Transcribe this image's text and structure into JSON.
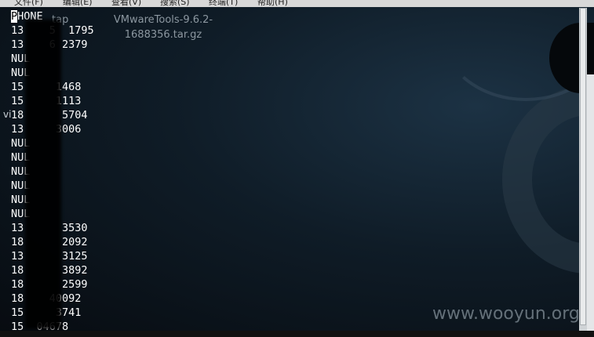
{
  "menubar": {
    "items": [
      "文件(F)",
      "编辑(E)",
      "查看(V)",
      "搜索(S)",
      "终端(T)",
      "帮助(H)"
    ]
  },
  "desktop": {
    "icon_left_label": "tap",
    "icon_label_line1": "VMwareTools-9.6.2-",
    "icon_label_line2": "1688356.tar.gz",
    "left_fragment": "vi"
  },
  "terminal": {
    "header": "PHONE",
    "rows": [
      "13    5  1795",
      "13    6 2379",
      "NUL",
      "NUL",
      "15     1468",
      "15     1113",
      "18      5704",
      "13     3006",
      "NUL",
      "NUL",
      "NUL",
      "NUL",
      "NUL",
      "NUL",
      "13      3530",
      "18      2092",
      "13      3125",
      "18      3892",
      "18      2599",
      "18    40092",
      "15     3741",
      "15  04678"
    ]
  },
  "watermark": "www.wooyun.org"
}
